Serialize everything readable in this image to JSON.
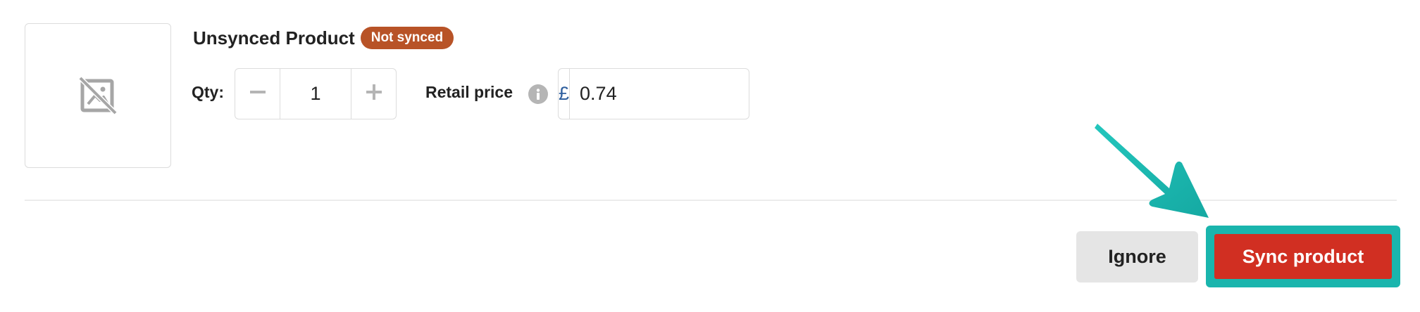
{
  "product": {
    "name": "Unsynced Product",
    "status_badge": "Not synced",
    "image_icon": "image-unavailable-icon"
  },
  "quantity": {
    "label": "Qty:",
    "value": "1",
    "decrement_icon": "minus-icon",
    "increment_icon": "plus-icon"
  },
  "retail_price": {
    "label": "Retail price",
    "info_icon": "info-icon",
    "currency_symbol": "£",
    "value": "0.74"
  },
  "actions": {
    "ignore_label": "Ignore",
    "sync_label": "Sync product"
  },
  "annotation": {
    "arrow_icon": "pointer-arrow-icon",
    "highlight_color": "#1ab5ad"
  },
  "colors": {
    "badge": "#b85327",
    "primary_button": "#d12f22",
    "secondary_button": "#e5e5e5",
    "currency": "#2f5f9e"
  }
}
